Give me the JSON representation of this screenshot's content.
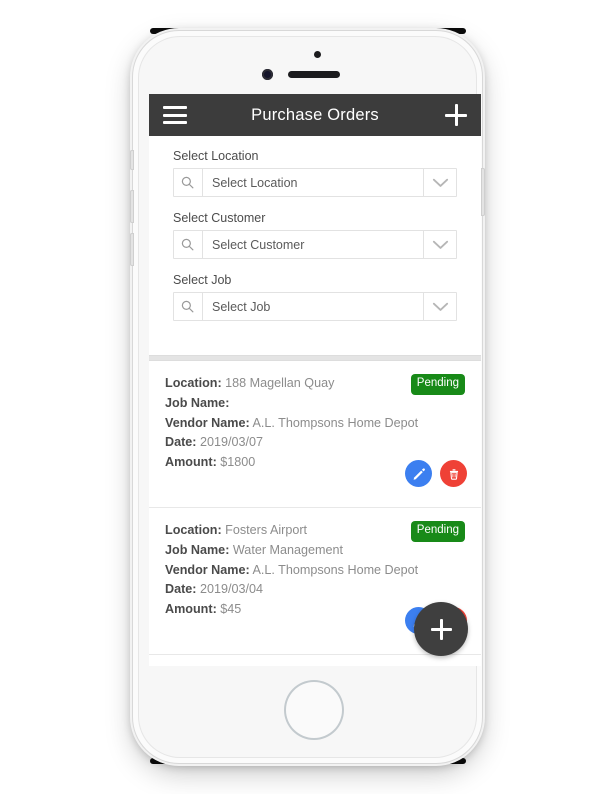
{
  "app": {
    "title": "Purchase Orders",
    "menu_icon": "hamburger-icon",
    "add_icon": "plus-icon"
  },
  "filters": [
    {
      "label": "Select Location",
      "placeholder": "Select Location",
      "value": "Select Location",
      "search_icon": "search-icon",
      "caret_icon": "chevron-down-icon"
    },
    {
      "label": "Select Customer",
      "placeholder": "Select Customer",
      "value": "Select Customer",
      "search_icon": "search-icon",
      "caret_icon": "chevron-down-icon"
    },
    {
      "label": "Select Job",
      "placeholder": "Select Job",
      "value": "Select Job",
      "search_icon": "search-icon",
      "caret_icon": "chevron-down-icon"
    }
  ],
  "labels": {
    "location": "Location:",
    "job_name": "Job Name:",
    "vendor_name": "Vendor Name:",
    "date": "Date:",
    "amount": "Amount:"
  },
  "orders": [
    {
      "location": "188 Magellan Quay",
      "job_name": "",
      "vendor_name": "A.L. Thompsons Home Depot",
      "date": "2019/03/07",
      "amount": "$1800",
      "status": "Pending",
      "edit_icon": "pencil-icon",
      "delete_icon": "trash-icon"
    },
    {
      "location": "Fosters Airport",
      "job_name": "Water Management",
      "vendor_name": "A.L. Thompsons Home Depot",
      "date": "2019/03/04",
      "amount": "$45",
      "status": "Pending",
      "edit_icon": "pencil-icon",
      "delete_icon": "trash-icon"
    }
  ],
  "fab": {
    "icon": "plus-icon"
  },
  "colors": {
    "appbar": "#3c3c3c",
    "status_pending": "#188a18",
    "edit_button": "#3c7ff0",
    "delete_button": "#ef4136",
    "fab": "#3f3f3f"
  }
}
